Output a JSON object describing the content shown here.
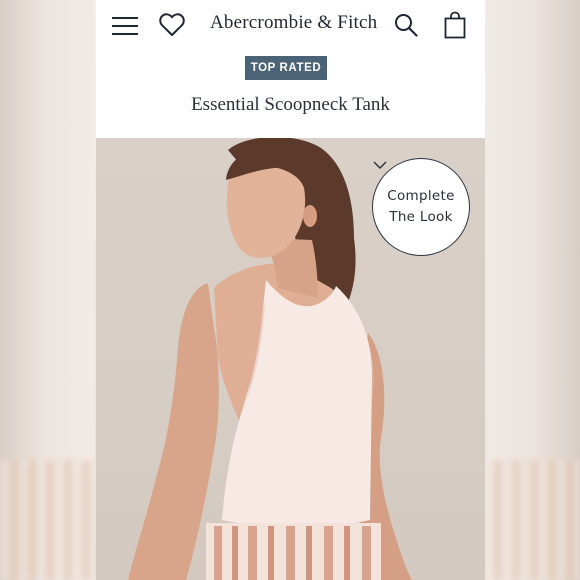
{
  "header": {
    "logo_text": "Abercrombie & Fitch",
    "icons": [
      "menu-icon",
      "heart-icon",
      "search-icon",
      "shopping-bag-icon"
    ]
  },
  "product": {
    "badge": "TOP RATED",
    "title": "Essential Scoopneck Tank"
  },
  "complete_the_look": {
    "line1": "Complete",
    "line2": "The Look",
    "icon": "chevron-down-icon"
  },
  "colors": {
    "badge_bg": "#4a6376",
    "text": "#1f2633"
  }
}
